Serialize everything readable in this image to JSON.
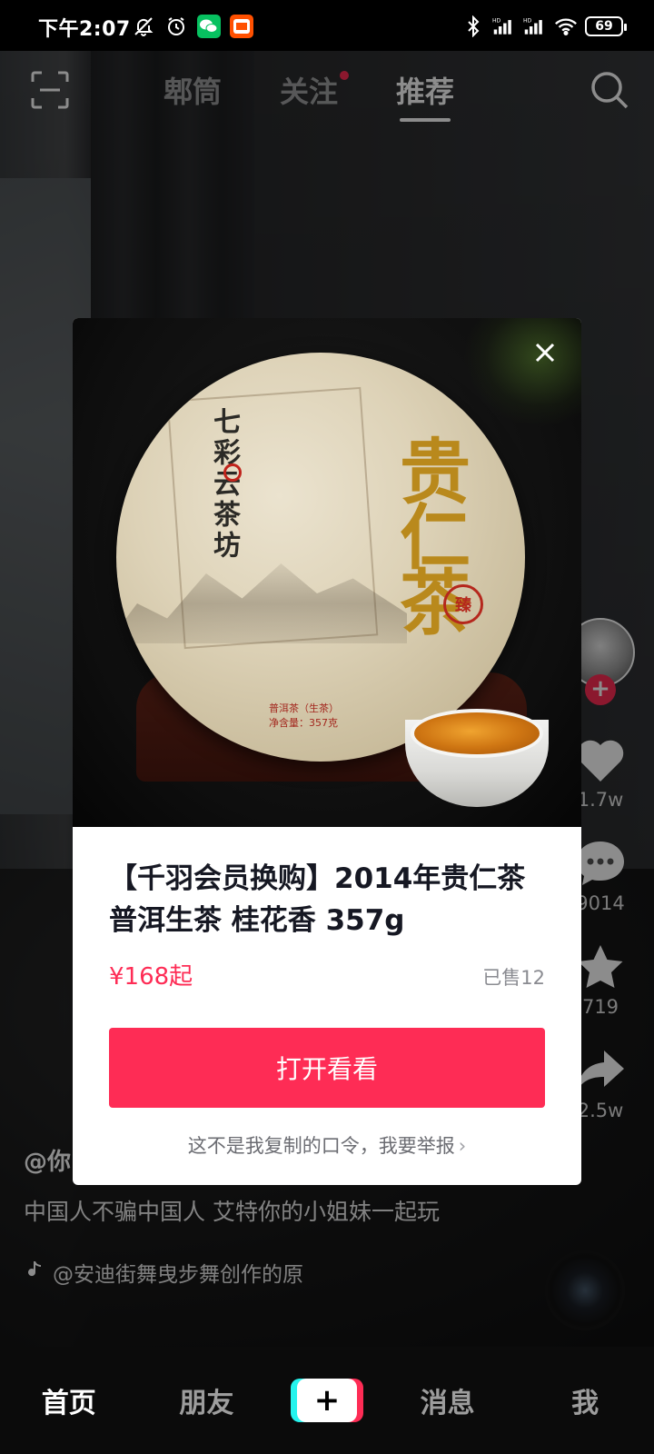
{
  "status_bar": {
    "time": "下午2:07",
    "battery": "69",
    "left_icons": [
      "bell-off-icon",
      "alarm-icon",
      "wechat-icon",
      "taobao-icon"
    ],
    "right_icons": [
      "bluetooth-icon",
      "signal-hd-icon",
      "signal-hd-icon",
      "wifi-icon",
      "battery-icon"
    ]
  },
  "top_nav": {
    "tabs": [
      {
        "label": "郫筒",
        "active": false
      },
      {
        "label": "关注",
        "active": false,
        "dot": true
      },
      {
        "label": "推荐",
        "active": true
      }
    ]
  },
  "right_actions": {
    "like_count": "1.7w",
    "comment_count": "9014",
    "favorite_count": "719",
    "share_count": "2.5w"
  },
  "video_info": {
    "author": "@你",
    "caption": "中国人不骗中国人 艾特你的小姐妹一起玩",
    "music": "@安迪街舞曳步舞创作的原"
  },
  "modal": {
    "image_brand": "七彩云茶坊",
    "image_gold_title": "贵仁茶",
    "image_seal": "臻",
    "image_label_line1": "普洱茶（生茶）",
    "image_label_line2": "净含量：357克",
    "title": "【千羽会员换购】2014年贵仁茶 普洱生茶 桂花香 357g",
    "price": "¥168起",
    "sold": "已售12",
    "open_button": "打开看看",
    "report_link": "这不是我复制的口令，我要举报"
  },
  "bottom_bar": {
    "tabs": [
      "首页",
      "朋友",
      "消息",
      "我"
    ],
    "add_symbol": "+"
  },
  "colors": {
    "accent": "#fe2c55",
    "cyan": "#25f4ee",
    "gold": "#b9891c"
  }
}
